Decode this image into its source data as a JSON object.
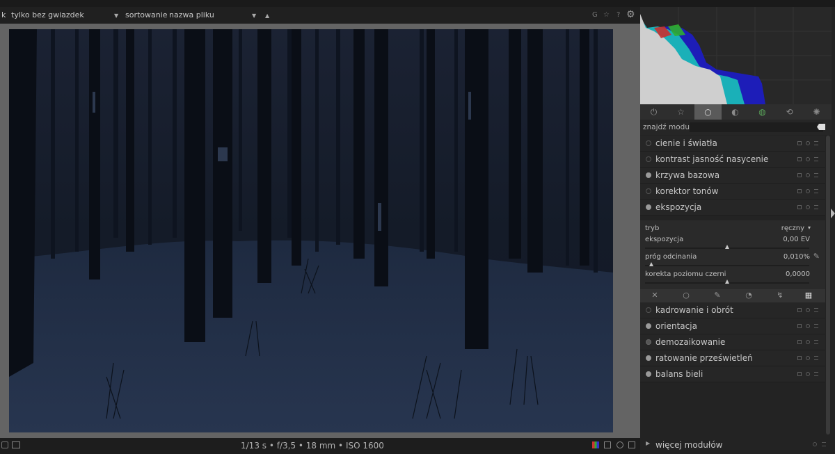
{
  "filterbar": {
    "cut_label": "k",
    "filter_value": "tylko bez gwiazdek",
    "sort_label": "sortowanie",
    "sort_value": "nazwa pliku",
    "sort_dir": "▲",
    "icon_g": "G",
    "icon_star": "☆",
    "icon_help": "?",
    "icon_gear": "⚙"
  },
  "footer": {
    "exif": "1/13 s • f/3,5 • 18 mm • ISO 1600"
  },
  "right_panel": {
    "groups": [
      {
        "icon": "⏻",
        "name": "power-group-icon"
      },
      {
        "icon": "☆",
        "name": "favorites-group-icon"
      },
      {
        "icon": "○",
        "name": "basic-group-icon"
      },
      {
        "icon": "◐",
        "name": "tone-group-icon"
      },
      {
        "icon": "◍",
        "name": "color-group-icon"
      },
      {
        "icon": "⟲",
        "name": "correct-group-icon"
      },
      {
        "icon": "✺",
        "name": "effect-group-icon"
      }
    ],
    "search_label": "znajdź moduł",
    "search_value": "",
    "modules_top": [
      {
        "label": "cienie i światła",
        "state": "off"
      },
      {
        "label": "kontrast jasność nasycenie",
        "state": "off"
      },
      {
        "label": "krzywa bazowa",
        "state": "on"
      },
      {
        "label": "korektor tonów",
        "state": "off"
      },
      {
        "label": "ekspozycja",
        "state": "on"
      }
    ],
    "exposure": {
      "mode_label": "tryb",
      "mode_value": "ręczny",
      "mode_caret": "▾",
      "exposure_label": "ekspozycja",
      "exposure_value": "0,00 EV",
      "exposure_level": 0.5,
      "clip_label": "próg odcinania",
      "clip_value": "0,010%",
      "clip_level": 0.04,
      "black_label": "korekta poziomu czerni",
      "black_value": "0,0000",
      "black_level": 0.5
    },
    "blend_icons": [
      "✕",
      "○",
      "✎",
      "◔",
      "↯",
      "▦"
    ],
    "modules_bottom": [
      {
        "label": "kadrowanie i obrót",
        "state": "off"
      },
      {
        "label": "orientacja",
        "state": "on"
      },
      {
        "label": "demozaikowanie",
        "state": "dim"
      },
      {
        "label": "ratowanie prześwietleń",
        "state": "on"
      },
      {
        "label": "balans bieli",
        "state": "on"
      }
    ],
    "more_modules": "więcej modułów"
  },
  "colors": {
    "histogram_blue": "#1d1db8",
    "histogram_cyan": "#1ab0b8",
    "histogram_white": "#d0d0d0",
    "accent_active": "#5a5a5a"
  }
}
